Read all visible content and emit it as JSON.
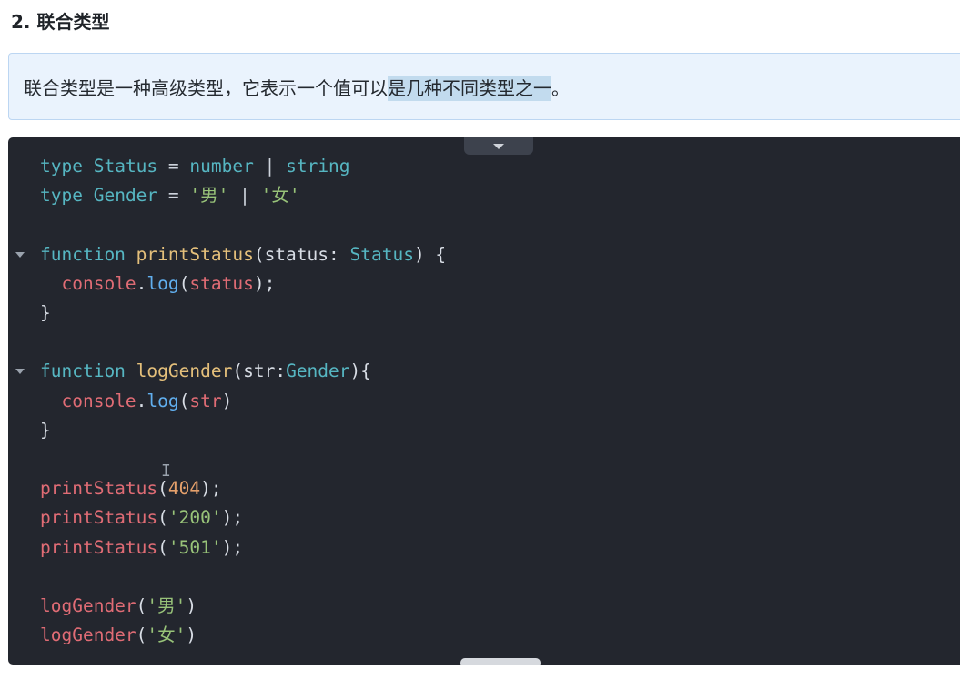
{
  "section": {
    "heading": "2. 联合类型"
  },
  "callout": {
    "text_before": "联合类型是一种高级类型，它表示一个值可以",
    "text_highlight": "是几种不同类型之一",
    "text_after": "。"
  },
  "code": {
    "lines": [
      [
        {
          "t": "type",
          "c": "kw"
        },
        {
          "t": " ",
          "c": "plain"
        },
        {
          "t": "Status",
          "c": "type"
        },
        {
          "t": " = ",
          "c": "op"
        },
        {
          "t": "number",
          "c": "kw"
        },
        {
          "t": " | ",
          "c": "op"
        },
        {
          "t": "string",
          "c": "kw"
        }
      ],
      [
        {
          "t": "type",
          "c": "kw"
        },
        {
          "t": " ",
          "c": "plain"
        },
        {
          "t": "Gender",
          "c": "type"
        },
        {
          "t": " = ",
          "c": "op"
        },
        {
          "t": "'男'",
          "c": "str"
        },
        {
          "t": " | ",
          "c": "op"
        },
        {
          "t": "'女'",
          "c": "str"
        }
      ],
      [],
      [
        {
          "t": "function",
          "c": "kw"
        },
        {
          "t": " ",
          "c": "plain"
        },
        {
          "t": "printStatus",
          "c": "fn"
        },
        {
          "t": "(",
          "c": "plain"
        },
        {
          "t": "status",
          "c": "plain"
        },
        {
          "t": ": ",
          "c": "plain"
        },
        {
          "t": "Status",
          "c": "type"
        },
        {
          "t": ") {",
          "c": "plain"
        }
      ],
      [
        {
          "t": "  ",
          "c": "plain"
        },
        {
          "t": "console",
          "c": "obj"
        },
        {
          "t": ".",
          "c": "plain"
        },
        {
          "t": "log",
          "c": "method"
        },
        {
          "t": "(",
          "c": "plain"
        },
        {
          "t": "status",
          "c": "param"
        },
        {
          "t": ");",
          "c": "plain"
        }
      ],
      [
        {
          "t": "}",
          "c": "plain"
        }
      ],
      [],
      [
        {
          "t": "function",
          "c": "kw"
        },
        {
          "t": " ",
          "c": "plain"
        },
        {
          "t": "logGender",
          "c": "fn"
        },
        {
          "t": "(",
          "c": "plain"
        },
        {
          "t": "str",
          "c": "plain"
        },
        {
          "t": ":",
          "c": "plain"
        },
        {
          "t": "Gender",
          "c": "type"
        },
        {
          "t": "){",
          "c": "plain"
        }
      ],
      [
        {
          "t": "  ",
          "c": "plain"
        },
        {
          "t": "console",
          "c": "obj"
        },
        {
          "t": ".",
          "c": "plain"
        },
        {
          "t": "log",
          "c": "method"
        },
        {
          "t": "(",
          "c": "plain"
        },
        {
          "t": "str",
          "c": "param"
        },
        {
          "t": ")",
          "c": "plain"
        }
      ],
      [
        {
          "t": "}",
          "c": "plain"
        }
      ],
      [],
      [
        {
          "t": "printStatus",
          "c": "call"
        },
        {
          "t": "(",
          "c": "plain"
        },
        {
          "t": "404",
          "c": "num"
        },
        {
          "t": ");",
          "c": "plain"
        }
      ],
      [
        {
          "t": "printStatus",
          "c": "call"
        },
        {
          "t": "(",
          "c": "plain"
        },
        {
          "t": "'200'",
          "c": "str"
        },
        {
          "t": ");",
          "c": "plain"
        }
      ],
      [
        {
          "t": "printStatus",
          "c": "call"
        },
        {
          "t": "(",
          "c": "plain"
        },
        {
          "t": "'501'",
          "c": "str"
        },
        {
          "t": ");",
          "c": "plain"
        }
      ],
      [],
      [
        {
          "t": "logGender",
          "c": "call"
        },
        {
          "t": "(",
          "c": "plain"
        },
        {
          "t": "'男'",
          "c": "str"
        },
        {
          "t": ")",
          "c": "plain"
        }
      ],
      [
        {
          "t": "logGender",
          "c": "call"
        },
        {
          "t": "(",
          "c": "plain"
        },
        {
          "t": "'女'",
          "c": "str"
        },
        {
          "t": ")",
          "c": "plain"
        }
      ]
    ],
    "foldable_lines": [
      3,
      7
    ]
  },
  "icons": {
    "collapse": "collapse-triangle-icon",
    "fold": "fold-chevron-icon",
    "cursor": "text-cursor-icon"
  },
  "colors": {
    "code_background": "#23262e",
    "keyword": "#56b6c2",
    "function_name": "#e5c07b",
    "call": "#e06c75",
    "string": "#98c379",
    "number": "#e5a06b",
    "method": "#61afef",
    "callout_background": "#eaf3fd",
    "highlight": "#c2dbee"
  }
}
